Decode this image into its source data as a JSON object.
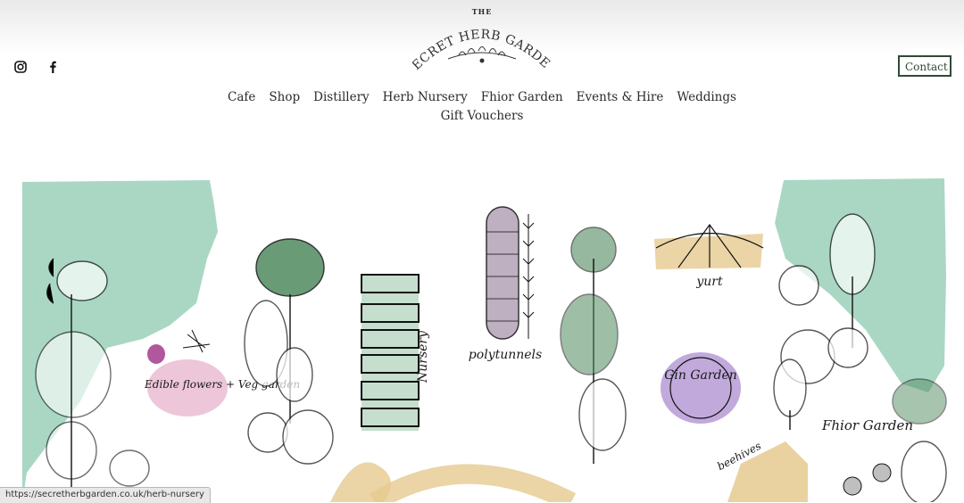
{
  "brand": {
    "the": "THE",
    "name": "SECRET HERB GARDEN"
  },
  "social": {
    "icons": [
      "instagram-icon",
      "facebook-icon"
    ]
  },
  "header": {
    "contact_label": "Contact"
  },
  "nav": {
    "items": [
      "Cafe",
      "Shop",
      "Distillery",
      "Herb Nursery",
      "Fhior Garden",
      "Events & Hire",
      "Weddings",
      "Gift Vouchers"
    ]
  },
  "map_labels": {
    "edible": "Edible flowers + Veg garden",
    "nursery": "Nursery",
    "polytunnels": "polytunnels",
    "yurt": "yurt",
    "gin": "Gin Garden",
    "beehives": "beehives",
    "fhior": "Fhior Garden"
  },
  "status_bar": {
    "url": "https://secretherbgarden.co.uk/herb-nursery"
  },
  "colors": {
    "accent": "#2f4a36",
    "watercolor_green": "#8ec9b0",
    "lilac": "#b79ad6",
    "sand": "#e6c98f"
  }
}
